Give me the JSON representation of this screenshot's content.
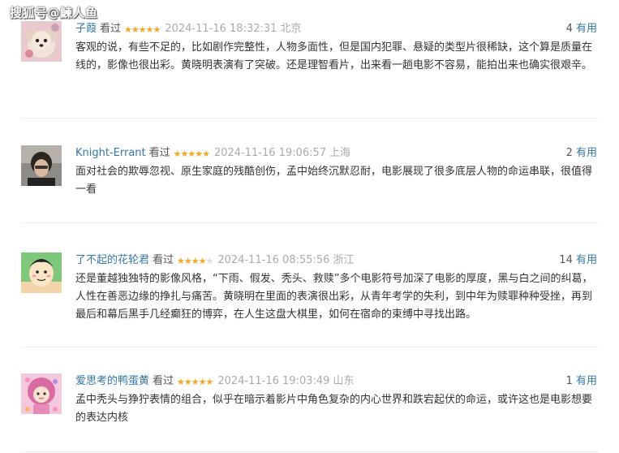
{
  "watermark": "搜狐号@鰊人鱼",
  "reviews": [
    {
      "username": "子葭",
      "watched": "看过",
      "rating": 5,
      "time": "2024-11-16 18:32:31",
      "location": "北京",
      "useful_count": "4",
      "useful_label": "有用",
      "text": "客观的说，有些不足的，比如剧作完整性，人物多面性，但是国内犯罪、悬疑的类型片很稀缺，这个算是质量在线的，影像也很出彩。黄晓明表演有了突破。还是理智看片，出来看一趟电影不容易，能拍出来也确实很艰辛。"
    },
    {
      "username": "Knight-Errant",
      "watched": "看过",
      "rating": 5,
      "time": "2024-11-16 19:06:57",
      "location": "上海",
      "useful_count": "2",
      "useful_label": "有用",
      "text": "面对社会的欺辱忽视、原生家庭的残酷创伤，孟中始终沉默忍耐，电影展现了很多底层人物的命运串联，很值得一看"
    },
    {
      "username": "了不起的花轮君",
      "watched": "看过",
      "rating": 4,
      "time": "2024-11-16 08:55:56",
      "location": "浙江",
      "useful_count": "14",
      "useful_label": "有用",
      "text": "还是董越独独特的影像风格，“下雨、假发、秃头、救赎”多个电影符号加深了电影的厚度，黑与白之间的纠葛，人性在善恶边缘的挣扎与痛苦。黄晓明在里面的表演很出彩，从青年考学的失利，到中年为赎罪种种受挫，再到最后和幕后黑手几经癫狂的博弈，在人生这盘大棋里，如何在宿命的束缚中寻找出路。"
    },
    {
      "username": "爱思考的鸭蛋黄",
      "watched": "看过",
      "rating": 5,
      "time": "2024-11-16 19:03:49",
      "location": "山东",
      "useful_count": "1",
      "useful_label": "有用",
      "text": "孟中秃头与狰狞表情的组合，似乎在暗示着影片中角色复杂的内心世界和跌宕起伏的命运，或许这也是电影想要的表达内核"
    }
  ],
  "colors": {
    "username": "#3377aa",
    "star": "#f5a623",
    "meta_gray": "#aaaaaa",
    "divider": "#eeeeee"
  }
}
